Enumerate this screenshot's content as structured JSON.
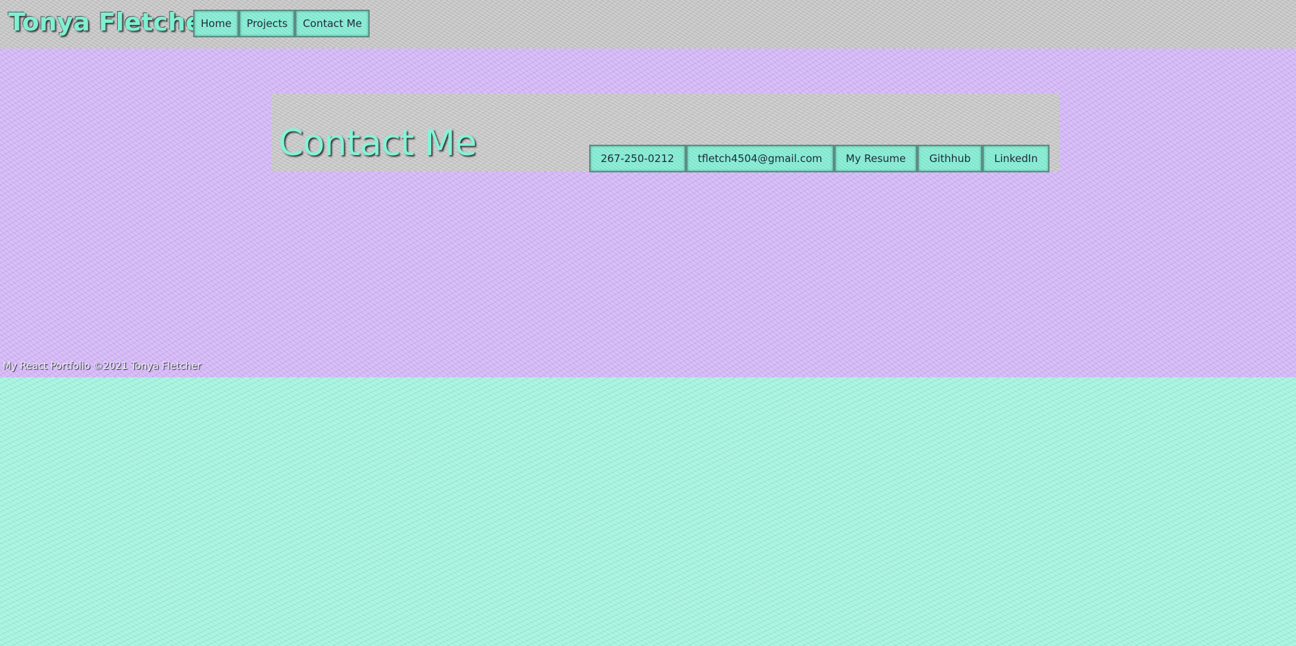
{
  "header": {
    "brand": "Tonya Fletcher",
    "nav": [
      {
        "label": "Home"
      },
      {
        "label": "Projects"
      },
      {
        "label": "Contact Me"
      }
    ]
  },
  "contact": {
    "title": "Contact Me",
    "links": [
      {
        "label": "267-250-0212"
      },
      {
        "label": "tfletch4504@gmail.com"
      },
      {
        "label": "My Resume"
      },
      {
        "label": "Githhub"
      },
      {
        "label": "LinkedIn"
      }
    ]
  },
  "footer": {
    "text": "My React Portfolio ©2021 Tonya Fletcher"
  },
  "colors": {
    "header_bg": "#c4c4c4",
    "band_bg": "#d3b8f5",
    "page_bg": "#a6f3df",
    "button_bg": "#7fe8cf",
    "accent_text": "#86f2d6"
  }
}
